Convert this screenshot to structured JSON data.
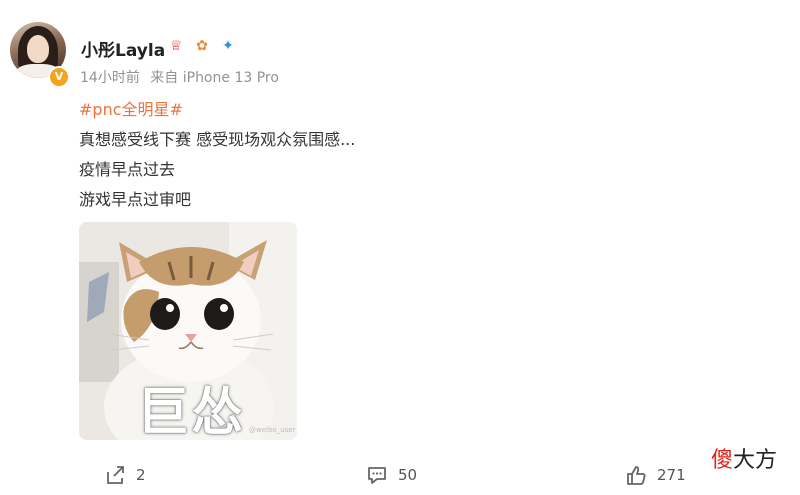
{
  "user": {
    "name": "小彤Layla",
    "verified_badge": "V",
    "badges": [
      "vip-crown-icon",
      "fan-badge-icon",
      "blue-planet-icon"
    ]
  },
  "post_meta": {
    "time": "14小时前",
    "source": "来自 iPhone 13 Pro"
  },
  "content": {
    "hashtag": "#pnc全明星#",
    "lines": [
      "真想感受线下赛 感受现场观众氛围感...",
      "疫情早点过去",
      "游戏早点过审吧"
    ]
  },
  "image": {
    "caption": "巨怂",
    "watermark": "@weibo_user"
  },
  "actions": {
    "repost_count": "2",
    "comment_count": "50",
    "like_count": "271"
  },
  "corner_mark": {
    "first": "傻",
    "rest": "大方"
  },
  "colors": {
    "hashtag": "#eb7340",
    "text": "#333333",
    "meta": "#939393",
    "verified": "#f7a21b"
  }
}
